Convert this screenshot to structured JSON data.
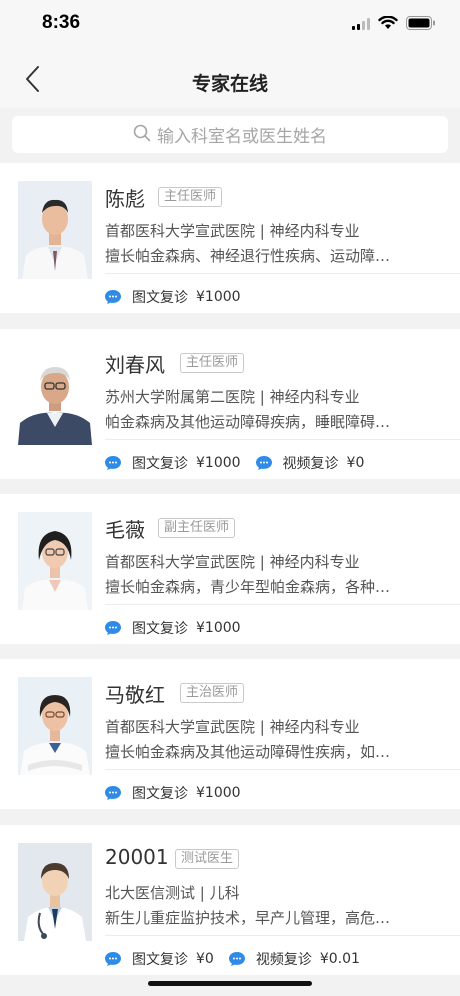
{
  "status": {
    "time": "8:36"
  },
  "nav": {
    "title": "专家在线"
  },
  "search": {
    "placeholder": "输入科室名或医生姓名"
  },
  "doctors": [
    {
      "name": "陈彪",
      "title": "主任医师",
      "hospital": "首都医科大学宣武医院 | 神经内科专业",
      "specialty": "擅长帕金森病、神经退行性疾病、运动障…",
      "services": [
        {
          "label": "图文复诊",
          "price": "¥1000"
        }
      ]
    },
    {
      "name": "刘春风",
      "title": "主任医师",
      "hospital": "苏州大学附属第二医院 | 神经内科专业",
      "specialty": "帕金森病及其他运动障碍疾病，睡眠障碍…",
      "services": [
        {
          "label": "图文复诊",
          "price": "¥1000"
        },
        {
          "label": "视频复诊",
          "price": "¥0"
        }
      ]
    },
    {
      "name": "毛薇",
      "title": "副主任医师",
      "hospital": "首都医科大学宣武医院 | 神经内科专业",
      "specialty": "擅长帕金森病，青少年型帕金森病，各种…",
      "services": [
        {
          "label": "图文复诊",
          "price": "¥1000"
        }
      ]
    },
    {
      "name": "马敬红",
      "title": "主治医师",
      "hospital": "首都医科大学宣武医院 | 神经内科专业",
      "specialty": "擅长帕金森病及其他运动障碍性疾病，如…",
      "services": [
        {
          "label": "图文复诊",
          "price": "¥1000"
        }
      ]
    },
    {
      "name": "20001",
      "title": "测试医生",
      "hospital": "北大医信测试 | 儿科",
      "specialty": "新生儿重症监护技术，早产儿管理，高危…",
      "services": [
        {
          "label": "图文复诊",
          "price": "¥0"
        },
        {
          "label": "视频复诊",
          "price": "¥0.01"
        }
      ]
    }
  ],
  "colors": {
    "accent_blue": "#2f8be6",
    "background": "#f2f2f2"
  }
}
